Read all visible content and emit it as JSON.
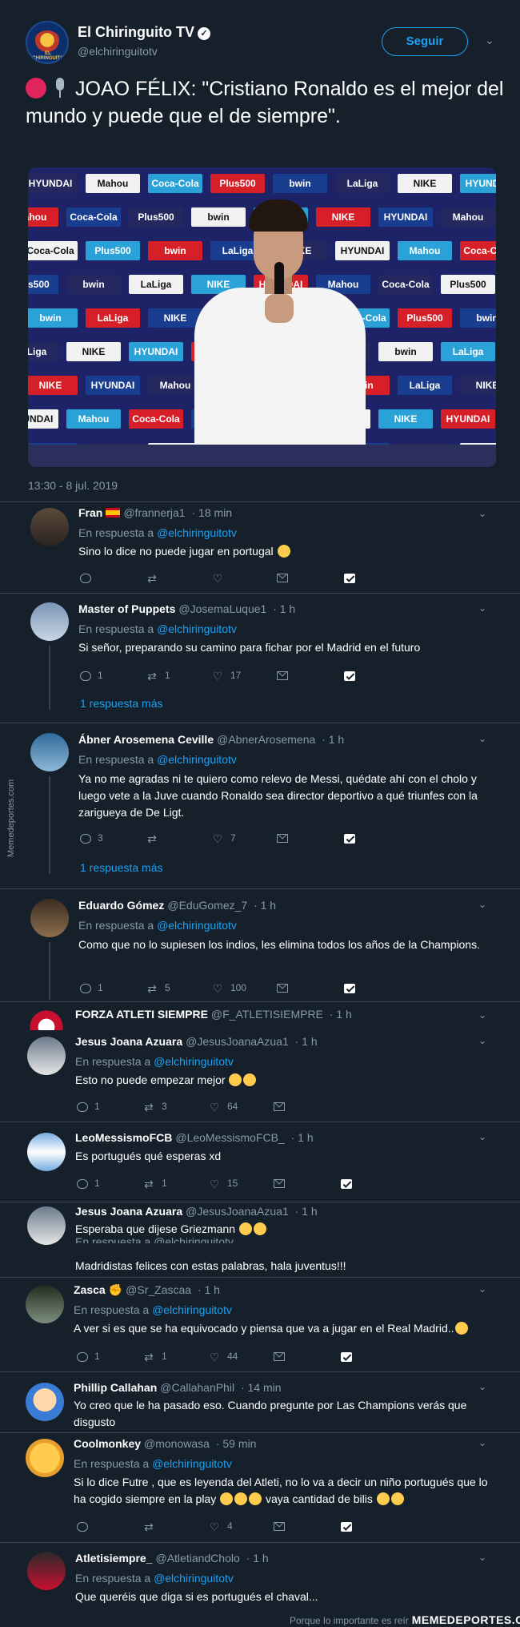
{
  "header": {
    "author_name": "El Chiringuito TV",
    "author_handle": "@elchiringuitotv",
    "avatar_text": "EL CHIRINGUITO",
    "follow_label": "Seguir"
  },
  "tweet": {
    "text": "JOAO FÉLIX: \"Cristiano Ronaldo es el mejor del mundo y puede que el de siempre\".",
    "timestamp": "13:30 - 8 jul. 2019"
  },
  "photo_logos": [
    "HYUNDAI",
    "Mahou",
    "Coca-Cola",
    "Plus500",
    "bwin",
    "LaLiga",
    "NIKE"
  ],
  "in_reply_prefix": "En respuesta a",
  "in_reply_mention": "@elchiringuitotv",
  "replies": [
    {
      "name": "Fran",
      "handle": "@frannerja1",
      "time": "· 18 min",
      "text": "Sino lo dice no puede jugar en portugal",
      "reply_count": "",
      "retweets": "",
      "likes": ""
    },
    {
      "name": "Master of Puppets",
      "handle": "@JosemaLuque1",
      "time": "· 1 h",
      "text": "Si señor, preparando su camino para fichar por el Madrid en el futuro",
      "reply_count": "1",
      "retweets": "1",
      "likes": "17",
      "more": "1 respuesta más"
    },
    {
      "name": "Ábner Arosemena Ceville",
      "handle": "@AbnerArosemena",
      "time": "· 1 h",
      "text": "Ya no me agradas ni te quiero como relevo de Messi, quédate ahí con el cholo y luego vete a la Juve cuando Ronaldo sea director deportivo a qué triunfes con la zarigueya de De Ligt.",
      "reply_count": "3",
      "retweets": "",
      "likes": "7",
      "more": "1 respuesta más"
    },
    {
      "name": "Eduardo Gómez",
      "handle": "@EduGomez_7",
      "time": "· 1 h",
      "text": "Como que no lo supiesen los indios, les elimina todos los años de la Champions.",
      "reply_count": "1",
      "retweets": "5",
      "likes": "100"
    },
    {
      "name": "FORZA ATLETI SIEMPRE",
      "handle": "@F_ATLETISIEMPRE",
      "time": "· 1 h"
    },
    {
      "name": "Jesus Joana Azuara",
      "handle": "@JesusJoanaAzua1",
      "time": "· 1 h",
      "text": "Esto no puede empezar mejor",
      "reply_count": "1",
      "retweets": "3",
      "likes": "64"
    },
    {
      "name": "LeoMessismoFCB",
      "handle": "@LeoMessismoFCB_",
      "time": "· 1 h",
      "text": "Es portugués qué esperas xd",
      "reply_count": "1",
      "retweets": "1",
      "likes": "15"
    },
    {
      "name": "Jesus Joana Azuara",
      "handle": "@JesusJoanaAzua1",
      "time": "· 1 h",
      "text": "Esperaba que dijese Griezmann",
      "text2": "Madridistas felices con estas palabras, hala juventus!!!"
    },
    {
      "name": "Zasca",
      "handle": "@Sr_Zascaa",
      "time": "· 1 h",
      "text": "A ver si es que se ha equivocado y piensa que va a jugar en el Real Madrid..",
      "reply_count": "1",
      "retweets": "1",
      "likes": "44"
    },
    {
      "name": "Phillip Callahan",
      "handle": "@CallahanPhil",
      "time": "· 14 min",
      "text": "Yo creo que le ha pasado eso. Cuando pregunte por Las Champions verás que disgusto"
    },
    {
      "name": "Coolmonkey",
      "handle": "@monowasa",
      "time": "· 59 min",
      "text": "Si lo dice Futre , que es leyenda del Atleti, no lo va a decir un niño portugués que lo ha cogido siempre en la play",
      "text_tail": "vaya cantidad de bilis",
      "reply_count": "",
      "retweets": "",
      "likes": "4"
    },
    {
      "name": "Atletisiempre_",
      "handle": "@AtletiandCholo",
      "time": "· 1 h",
      "text": "Que queréis que diga si es portugués el chaval..."
    }
  ],
  "watermark_side": "Memedeportes.com",
  "watermark_bottom_text": "Porque lo importante es reír",
  "watermark_bottom_brand": "MEMEDEPORTES.COM"
}
